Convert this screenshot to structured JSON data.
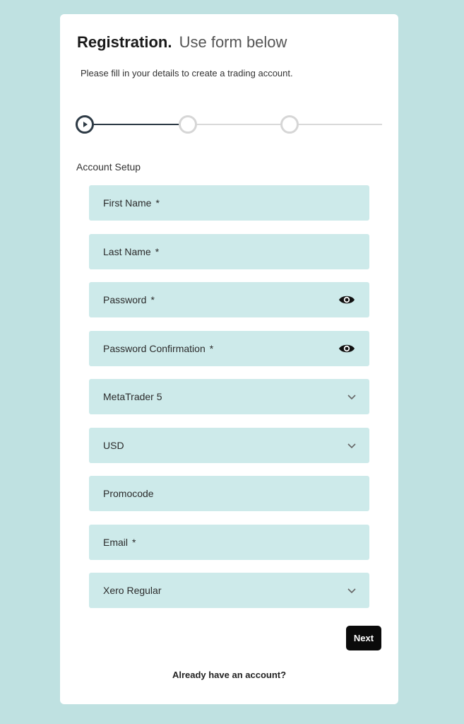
{
  "header": {
    "title_strong": "Registration.",
    "title_light": "Use form below",
    "subtitle": "Please fill in your details to create a trading account."
  },
  "stepper": {
    "steps": 3,
    "current_step": 1
  },
  "section": {
    "label": "Account Setup"
  },
  "fields": {
    "first_name": {
      "label": "First Name",
      "required": "*"
    },
    "last_name": {
      "label": "Last Name",
      "required": "*"
    },
    "password": {
      "label": "Password",
      "required": "*",
      "icon": "eye-icon"
    },
    "password_confirmation": {
      "label": "Password Confirmation",
      "required": "*",
      "icon": "eye-icon"
    },
    "platform": {
      "value": "MetaTrader 5",
      "icon": "chevron-down-icon"
    },
    "currency": {
      "value": "USD",
      "icon": "chevron-down-icon"
    },
    "promocode": {
      "label": "Promocode"
    },
    "email": {
      "label": "Email",
      "required": "*"
    },
    "account_type": {
      "value": "Xero Regular",
      "icon": "chevron-down-icon"
    }
  },
  "actions": {
    "next_label": "Next",
    "login_link": "Already have an account?"
  },
  "colors": {
    "page_background": "#bfe1e1",
    "field_background": "#cdeaea",
    "step_active": "#2d3a45",
    "step_inactive": "#d6d6d6",
    "button_background": "#0a0a0a"
  }
}
